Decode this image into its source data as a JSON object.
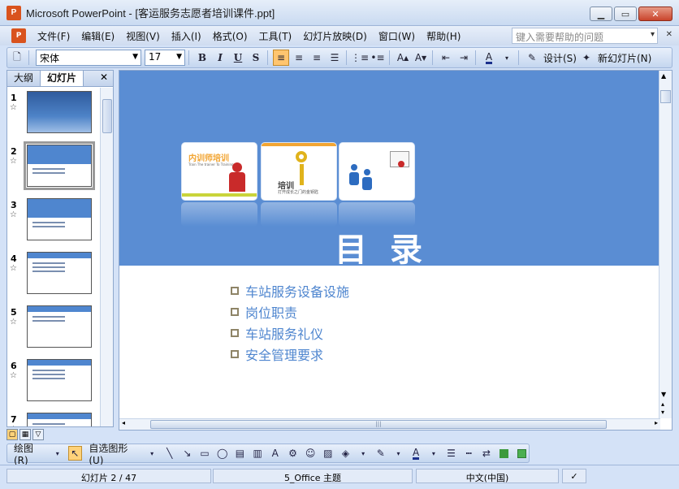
{
  "window": {
    "title": "Microsoft PowerPoint - [客运服务志愿者培训课件.ppt]",
    "app_icon": "powerpoint-icon",
    "minimize": "▁",
    "maximize": "▭",
    "close": "✕"
  },
  "menubar": {
    "items": [
      {
        "label": "文件(F)"
      },
      {
        "label": "编辑(E)"
      },
      {
        "label": "视图(V)"
      },
      {
        "label": "插入(I)"
      },
      {
        "label": "格式(O)"
      },
      {
        "label": "工具(T)"
      },
      {
        "label": "幻灯片放映(D)"
      },
      {
        "label": "窗口(W)"
      },
      {
        "label": "帮助(H)"
      }
    ],
    "help_placeholder": "键入需要帮助的问题",
    "help_arrow": "▾",
    "close_icon": "✕"
  },
  "toolbar": {
    "font_name": "宋体",
    "font_size": "17",
    "bold": "B",
    "italic": "I",
    "underline": "U",
    "shadow": "S",
    "design_label": "设计(S)",
    "new_slide_label": "新幻灯片(N)"
  },
  "panel": {
    "tab_outline": "大纲",
    "tab_slides": "幻灯片",
    "close_icon": "✕"
  },
  "thumbnails": [
    {
      "num": "1",
      "star": "☆",
      "type": "title"
    },
    {
      "num": "2",
      "star": "☆",
      "type": "toc",
      "selected": true
    },
    {
      "num": "3",
      "star": "☆",
      "type": "toc"
    },
    {
      "num": "4",
      "star": "☆",
      "type": "text"
    },
    {
      "num": "5",
      "star": "☆",
      "type": "text"
    },
    {
      "num": "6",
      "star": "☆",
      "type": "text"
    },
    {
      "num": "7",
      "star": "☆",
      "type": "text"
    }
  ],
  "slide": {
    "cards": [
      {
        "title": "内训师培训",
        "subtitle": "Train The trainer To Training",
        "accent": "#c9d43a"
      },
      {
        "title": "培训",
        "subtitle": "打开成长之门的金钥匙",
        "accent": "#f2a533"
      },
      {
        "title": "",
        "subtitle": "",
        "accent": "#5a8dd3"
      }
    ],
    "title": "目录",
    "bullets": [
      "车站服务设备设施",
      "岗位职责",
      "车站服务礼仪",
      "安全管理要求"
    ]
  },
  "drawbar": {
    "draw_label": "绘图(R)",
    "autoshape_label": "自选图形(U)"
  },
  "status": {
    "slide_info": "幻灯片 2 / 47",
    "theme": "5_Office 主题",
    "language": "中文(中国)"
  },
  "colors": {
    "slide_blue": "#5a8dd3",
    "bullet_text": "#4f86cf",
    "bullet_box": "#8e8467"
  }
}
